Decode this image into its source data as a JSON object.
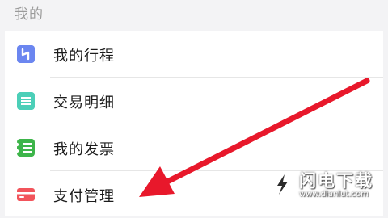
{
  "section": {
    "title": "我的"
  },
  "items": [
    {
      "label": "我的行程",
      "icon": "trip-icon",
      "color": "#6b86f0"
    },
    {
      "label": "交易明细",
      "icon": "transaction-details-icon",
      "color": "#4ccfb8"
    },
    {
      "label": "我的发票",
      "icon": "invoice-icon",
      "color": "#3db54a"
    },
    {
      "label": "支付管理",
      "icon": "card-icon",
      "color": "#f2545b"
    }
  ],
  "watermark": {
    "title": "闪电下载",
    "url": "www.dianlut.com"
  },
  "annotation": {
    "color": "#e8182b"
  }
}
